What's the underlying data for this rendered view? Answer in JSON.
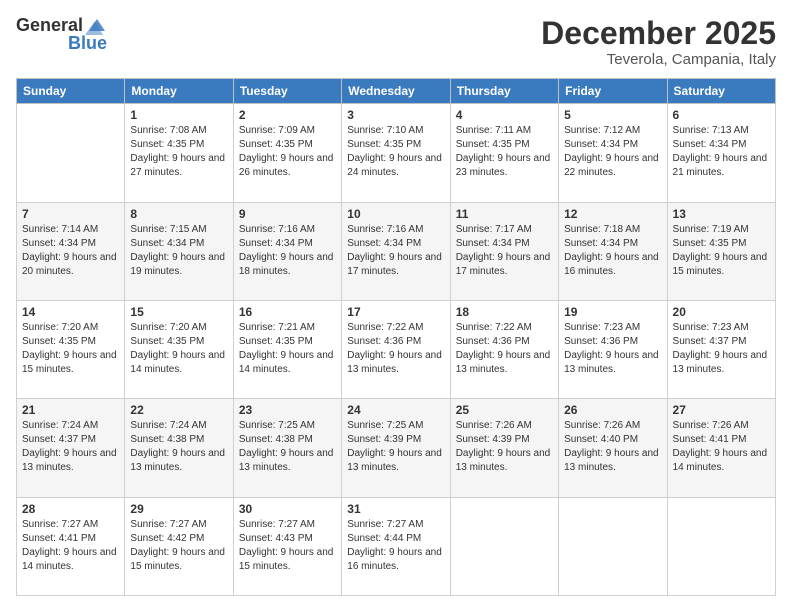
{
  "header": {
    "logo_general": "General",
    "logo_blue": "Blue",
    "month": "December 2025",
    "location": "Teverola, Campania, Italy"
  },
  "weekdays": [
    "Sunday",
    "Monday",
    "Tuesday",
    "Wednesday",
    "Thursday",
    "Friday",
    "Saturday"
  ],
  "weeks": [
    [
      {
        "day": "",
        "empty": true
      },
      {
        "day": "1",
        "sunrise": "7:08 AM",
        "sunset": "4:35 PM",
        "daylight": "9 hours and 27 minutes."
      },
      {
        "day": "2",
        "sunrise": "7:09 AM",
        "sunset": "4:35 PM",
        "daylight": "9 hours and 26 minutes."
      },
      {
        "day": "3",
        "sunrise": "7:10 AM",
        "sunset": "4:35 PM",
        "daylight": "9 hours and 24 minutes."
      },
      {
        "day": "4",
        "sunrise": "7:11 AM",
        "sunset": "4:35 PM",
        "daylight": "9 hours and 23 minutes."
      },
      {
        "day": "5",
        "sunrise": "7:12 AM",
        "sunset": "4:34 PM",
        "daylight": "9 hours and 22 minutes."
      },
      {
        "day": "6",
        "sunrise": "7:13 AM",
        "sunset": "4:34 PM",
        "daylight": "9 hours and 21 minutes."
      }
    ],
    [
      {
        "day": "7",
        "sunrise": "7:14 AM",
        "sunset": "4:34 PM",
        "daylight": "9 hours and 20 minutes."
      },
      {
        "day": "8",
        "sunrise": "7:15 AM",
        "sunset": "4:34 PM",
        "daylight": "9 hours and 19 minutes."
      },
      {
        "day": "9",
        "sunrise": "7:16 AM",
        "sunset": "4:34 PM",
        "daylight": "9 hours and 18 minutes."
      },
      {
        "day": "10",
        "sunrise": "7:16 AM",
        "sunset": "4:34 PM",
        "daylight": "9 hours and 17 minutes."
      },
      {
        "day": "11",
        "sunrise": "7:17 AM",
        "sunset": "4:34 PM",
        "daylight": "9 hours and 17 minutes."
      },
      {
        "day": "12",
        "sunrise": "7:18 AM",
        "sunset": "4:34 PM",
        "daylight": "9 hours and 16 minutes."
      },
      {
        "day": "13",
        "sunrise": "7:19 AM",
        "sunset": "4:35 PM",
        "daylight": "9 hours and 15 minutes."
      }
    ],
    [
      {
        "day": "14",
        "sunrise": "7:20 AM",
        "sunset": "4:35 PM",
        "daylight": "9 hours and 15 minutes."
      },
      {
        "day": "15",
        "sunrise": "7:20 AM",
        "sunset": "4:35 PM",
        "daylight": "9 hours and 14 minutes."
      },
      {
        "day": "16",
        "sunrise": "7:21 AM",
        "sunset": "4:35 PM",
        "daylight": "9 hours and 14 minutes."
      },
      {
        "day": "17",
        "sunrise": "7:22 AM",
        "sunset": "4:36 PM",
        "daylight": "9 hours and 13 minutes."
      },
      {
        "day": "18",
        "sunrise": "7:22 AM",
        "sunset": "4:36 PM",
        "daylight": "9 hours and 13 minutes."
      },
      {
        "day": "19",
        "sunrise": "7:23 AM",
        "sunset": "4:36 PM",
        "daylight": "9 hours and 13 minutes."
      },
      {
        "day": "20",
        "sunrise": "7:23 AM",
        "sunset": "4:37 PM",
        "daylight": "9 hours and 13 minutes."
      }
    ],
    [
      {
        "day": "21",
        "sunrise": "7:24 AM",
        "sunset": "4:37 PM",
        "daylight": "9 hours and 13 minutes."
      },
      {
        "day": "22",
        "sunrise": "7:24 AM",
        "sunset": "4:38 PM",
        "daylight": "9 hours and 13 minutes."
      },
      {
        "day": "23",
        "sunrise": "7:25 AM",
        "sunset": "4:38 PM",
        "daylight": "9 hours and 13 minutes."
      },
      {
        "day": "24",
        "sunrise": "7:25 AM",
        "sunset": "4:39 PM",
        "daylight": "9 hours and 13 minutes."
      },
      {
        "day": "25",
        "sunrise": "7:26 AM",
        "sunset": "4:39 PM",
        "daylight": "9 hours and 13 minutes."
      },
      {
        "day": "26",
        "sunrise": "7:26 AM",
        "sunset": "4:40 PM",
        "daylight": "9 hours and 13 minutes."
      },
      {
        "day": "27",
        "sunrise": "7:26 AM",
        "sunset": "4:41 PM",
        "daylight": "9 hours and 14 minutes."
      }
    ],
    [
      {
        "day": "28",
        "sunrise": "7:27 AM",
        "sunset": "4:41 PM",
        "daylight": "9 hours and 14 minutes."
      },
      {
        "day": "29",
        "sunrise": "7:27 AM",
        "sunset": "4:42 PM",
        "daylight": "9 hours and 15 minutes."
      },
      {
        "day": "30",
        "sunrise": "7:27 AM",
        "sunset": "4:43 PM",
        "daylight": "9 hours and 15 minutes."
      },
      {
        "day": "31",
        "sunrise": "7:27 AM",
        "sunset": "4:44 PM",
        "daylight": "9 hours and 16 minutes."
      },
      {
        "day": "",
        "empty": true
      },
      {
        "day": "",
        "empty": true
      },
      {
        "day": "",
        "empty": true
      }
    ]
  ]
}
